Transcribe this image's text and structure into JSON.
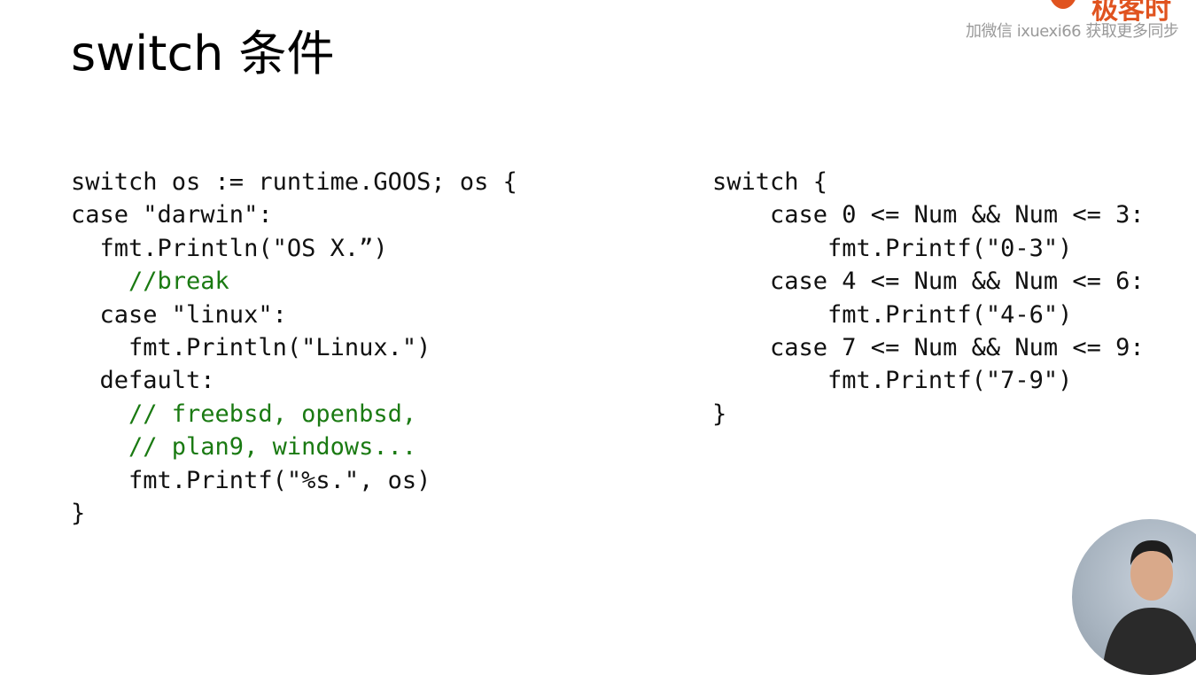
{
  "slide": {
    "title": "switch 条件"
  },
  "watermark": {
    "brand": "极客时",
    "text": "加微信 ixuexi66 获取更多同步"
  },
  "code_left": {
    "lines": [
      {
        "text": "switch os := runtime.GOOS; os {",
        "type": "code"
      },
      {
        "text": "case \"darwin\":",
        "type": "code"
      },
      {
        "text": "  fmt.Println(\"OS X.”)",
        "type": "code"
      },
      {
        "text": "    //break",
        "type": "comment"
      },
      {
        "text": "  case \"linux\":",
        "type": "code"
      },
      {
        "text": "    fmt.Println(\"Linux.\")",
        "type": "code"
      },
      {
        "text": "  default:",
        "type": "code"
      },
      {
        "text": "    // freebsd, openbsd,",
        "type": "comment"
      },
      {
        "text": "    // plan9, windows...",
        "type": "comment"
      },
      {
        "text": "    fmt.Printf(\"%s.\", os)",
        "type": "code"
      },
      {
        "text": "}",
        "type": "code"
      }
    ]
  },
  "code_right": {
    "lines": [
      {
        "text": "switch {",
        "type": "code"
      },
      {
        "text": "    case 0 <= Num && Num <= 3:",
        "type": "code"
      },
      {
        "text": "        fmt.Printf(\"0-3\")",
        "type": "code"
      },
      {
        "text": "    case 4 <= Num && Num <= 6:",
        "type": "code"
      },
      {
        "text": "        fmt.Printf(\"4-6\")",
        "type": "code"
      },
      {
        "text": "    case 7 <= Num && Num <= 9:",
        "type": "code"
      },
      {
        "text": "        fmt.Printf(\"7-9\")",
        "type": "code"
      },
      {
        "text": "}",
        "type": "code"
      }
    ]
  },
  "colors": {
    "code": "#111111",
    "comment": "#1a7a12",
    "brand": "#e0531f",
    "watermark_text": "#9a9a9a"
  }
}
